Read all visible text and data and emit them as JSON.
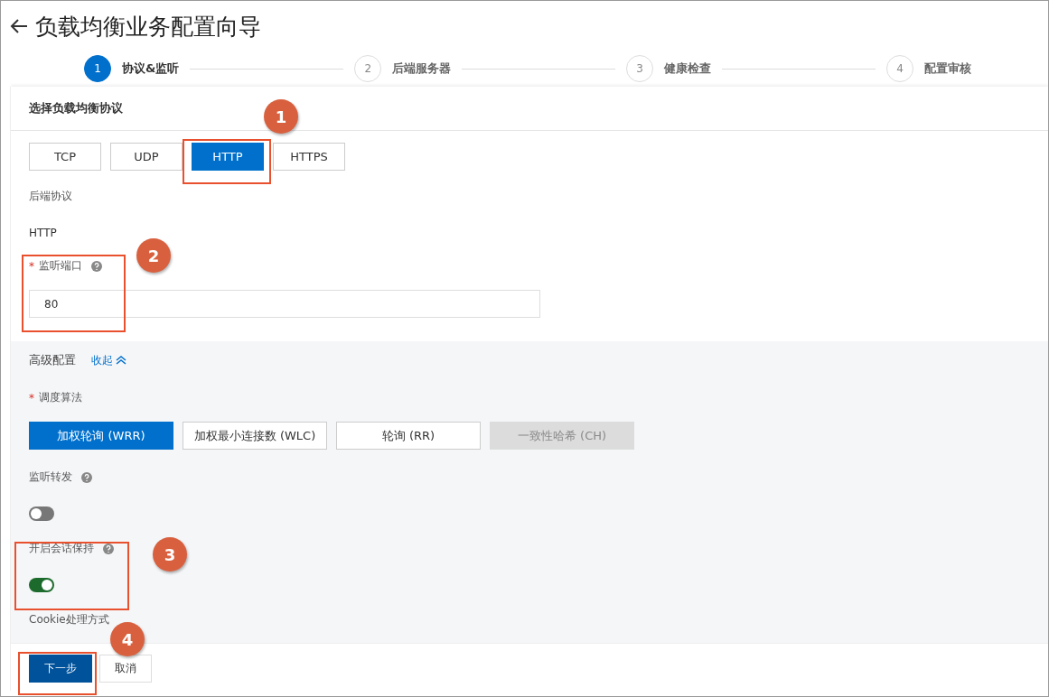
{
  "title": "负载均衡业务配置向导",
  "steps": [
    {
      "number": "1",
      "label": "协议&监听",
      "selected": true
    },
    {
      "number": "2",
      "label": "后端服务器",
      "selected": false
    },
    {
      "number": "3",
      "label": "健康检查",
      "selected": false
    },
    {
      "number": "4",
      "label": "配置审核",
      "selected": false
    }
  ],
  "section_title": "选择负载均衡协议",
  "protocols": [
    {
      "label": "TCP",
      "selected": false
    },
    {
      "label": "UDP",
      "selected": false
    },
    {
      "label": "HTTP",
      "selected": true
    },
    {
      "label": "HTTPS",
      "selected": false
    }
  ],
  "backend_protocol": {
    "label": "后端协议",
    "value": "HTTP"
  },
  "listen_port": {
    "label": "监听端口",
    "required_mark": "*",
    "value": "80"
  },
  "advanced": {
    "title": "高级配置",
    "toggle_link": "收起",
    "expanded": true
  },
  "algorithm": {
    "label": "调度算法",
    "required_mark": "*",
    "options": [
      {
        "label": "加权轮询 (WRR)",
        "selected": true,
        "disabled": false
      },
      {
        "label": "加权最小连接数 (WLC)",
        "selected": false,
        "disabled": false
      },
      {
        "label": "轮询 (RR)",
        "selected": false,
        "disabled": false
      },
      {
        "label": "一致性哈希 (CH)",
        "selected": false,
        "disabled": true
      }
    ]
  },
  "switches": [
    {
      "label": "监听转发",
      "on": false
    },
    {
      "label": "开启会话保持",
      "on": true
    }
  ],
  "cookie_label": "Cookie处理方式",
  "buttons": [
    {
      "label": "下一步",
      "kind": "primary"
    },
    {
      "label": "取消",
      "kind": "secondary"
    }
  ],
  "callouts": [
    "1",
    "2",
    "3",
    "4"
  ]
}
